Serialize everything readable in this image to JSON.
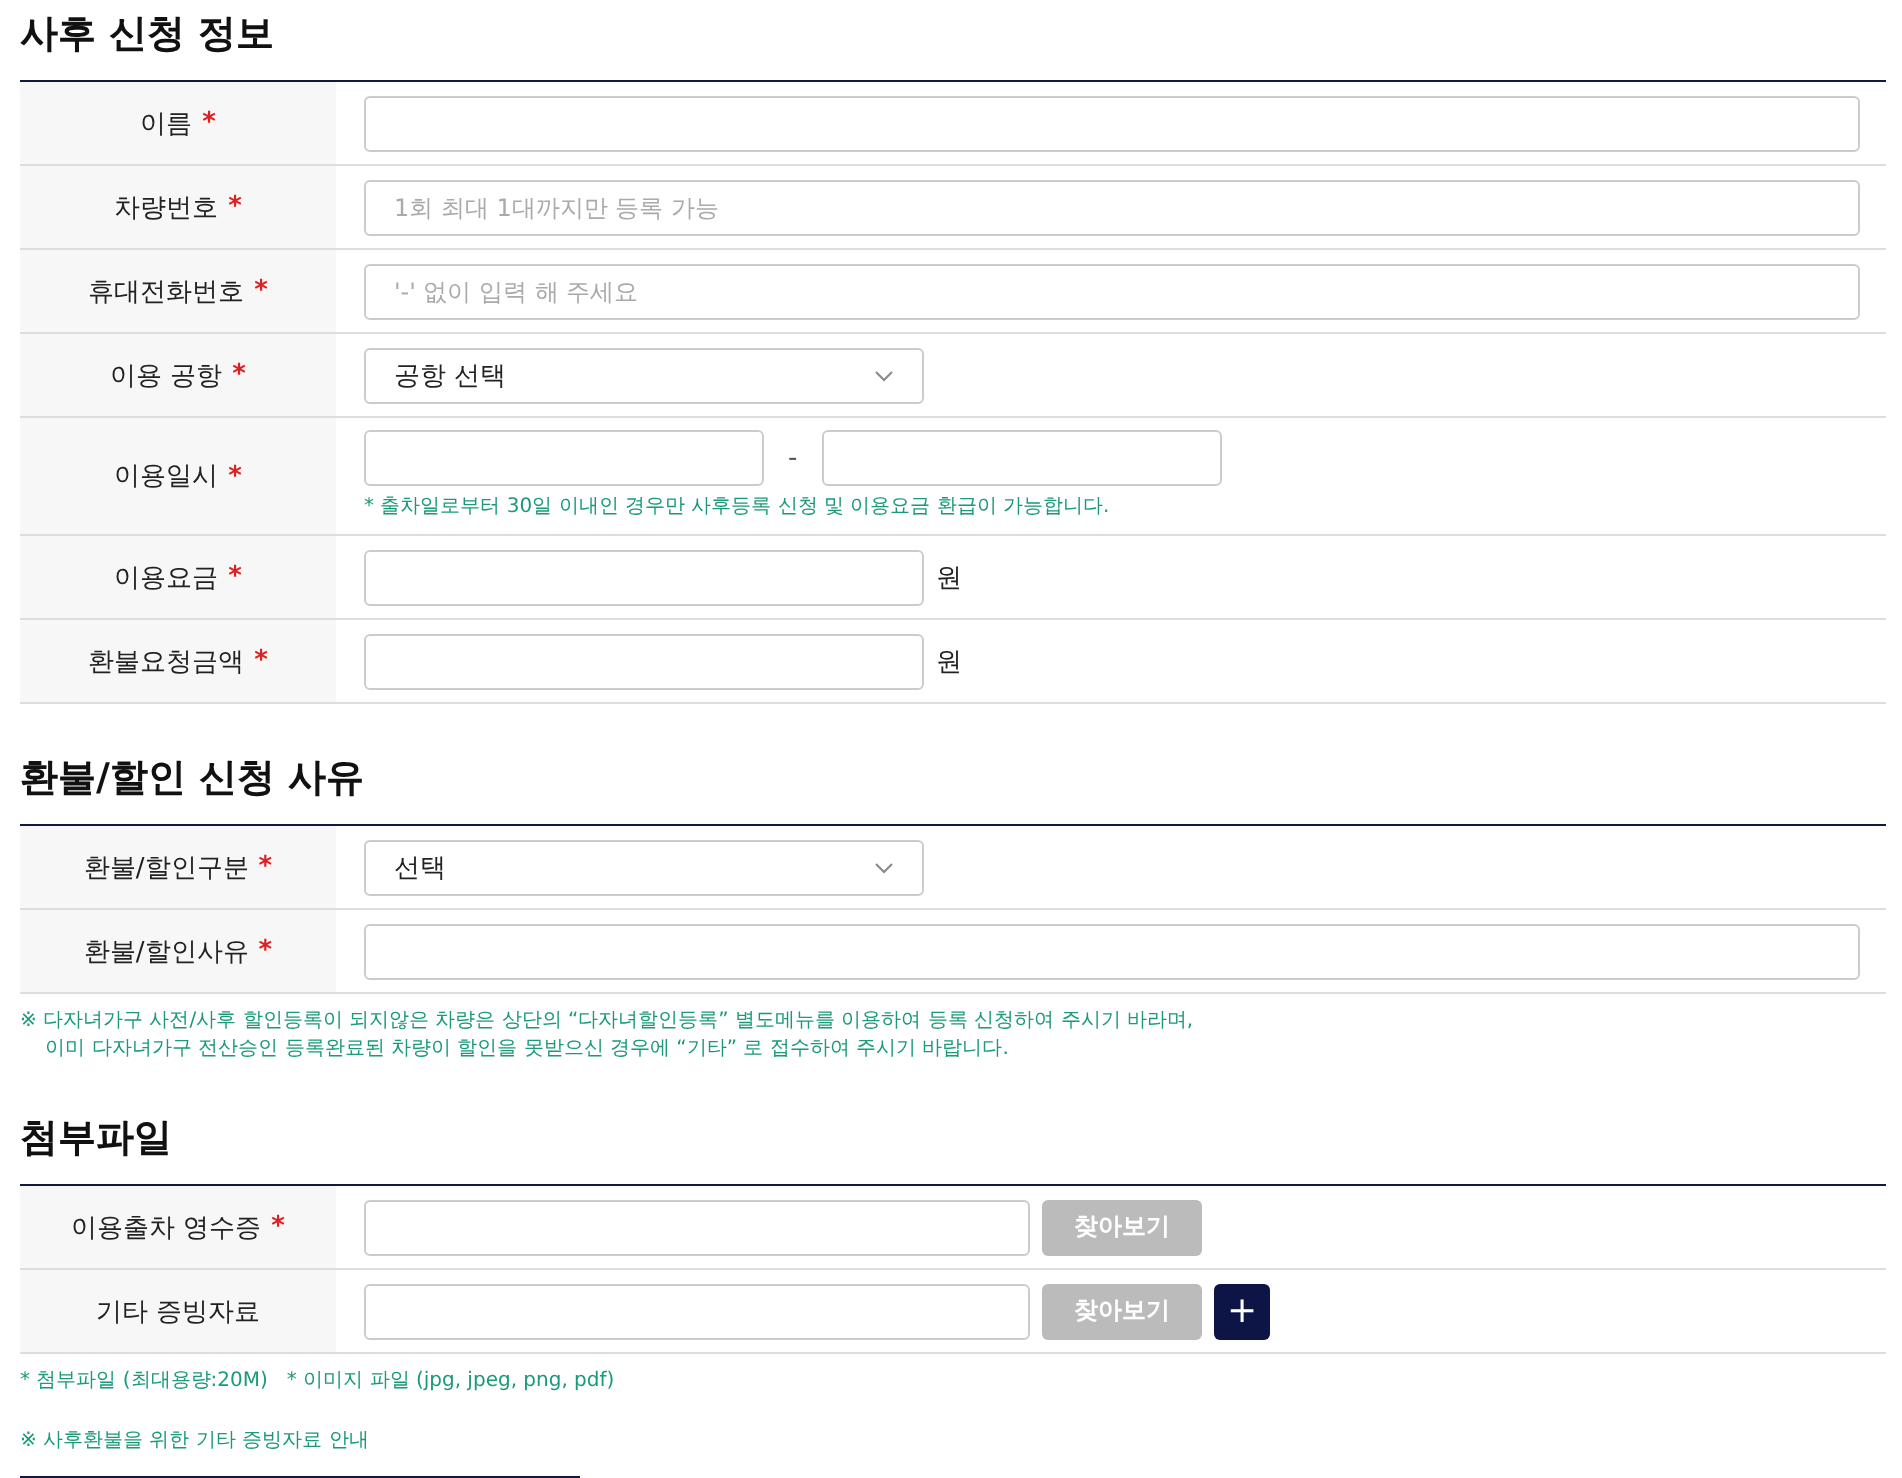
{
  "sections": [
    {
      "title": "사후 신청 정보",
      "rows": [
        {
          "kind": "text",
          "label": "이름",
          "required_mark": "*",
          "placeholder": ""
        },
        {
          "kind": "text",
          "label": "차량번호",
          "required_mark": "*",
          "placeholder": "1회 최대 1대까지만 등록 가능"
        },
        {
          "kind": "text",
          "label": "휴대전화번호",
          "required_mark": "*",
          "placeholder": "'-' 없이 입력 해 주세요"
        },
        {
          "kind": "select",
          "label": "이용 공항",
          "required_mark": "*",
          "value": "공항 선택"
        },
        {
          "kind": "daterange",
          "label": "이용일시",
          "required_mark": "*",
          "separator": "-",
          "note": "* 출차일로부터 30일 이내인 경우만 사후등록 신청 및 이용요금 환급이 가능합니다."
        },
        {
          "kind": "amount",
          "label": "이용요금",
          "required_mark": "*",
          "unit": "원"
        },
        {
          "kind": "amount",
          "label": "환불요청금액",
          "required_mark": "*",
          "unit": "원"
        }
      ]
    },
    {
      "title": "환불/할인 신청 사유",
      "rows": [
        {
          "kind": "select",
          "label": "환불/할인구분",
          "required_mark": "*",
          "value": "선택"
        },
        {
          "kind": "text",
          "label": "환불/할인사유",
          "required_mark": "*",
          "placeholder": ""
        }
      ],
      "notes": [
        "※ 다자녀가구 사전/사후 할인등록이 되지않은 차량은 상단의 “다자녀할인등록” 별도메뉴를 이용하여 등록 신청하여 주시기 바라며,\n    이미 다자녀가구 전산승인 등록완료된 차량이 할인을 못받으신 경우에 “기타” 로 접수하여 주시기 바랍니다."
      ]
    },
    {
      "title": "첨부파일",
      "rows": [
        {
          "kind": "file",
          "label": "이용출차 영수증",
          "required_mark": "*",
          "button": "찾아보기",
          "add": false
        },
        {
          "kind": "file",
          "label": "기타 증빙자료",
          "button": "찾아보기",
          "add": true,
          "add_label": "+"
        }
      ],
      "notes": [
        "* 첨부파일 (최대용량:20M)   * 이미지 파일 (jpg, jpeg, png, pdf)",
        "※ 사후환불을 위한 기타 증빙자료 안내"
      ]
    }
  ]
}
